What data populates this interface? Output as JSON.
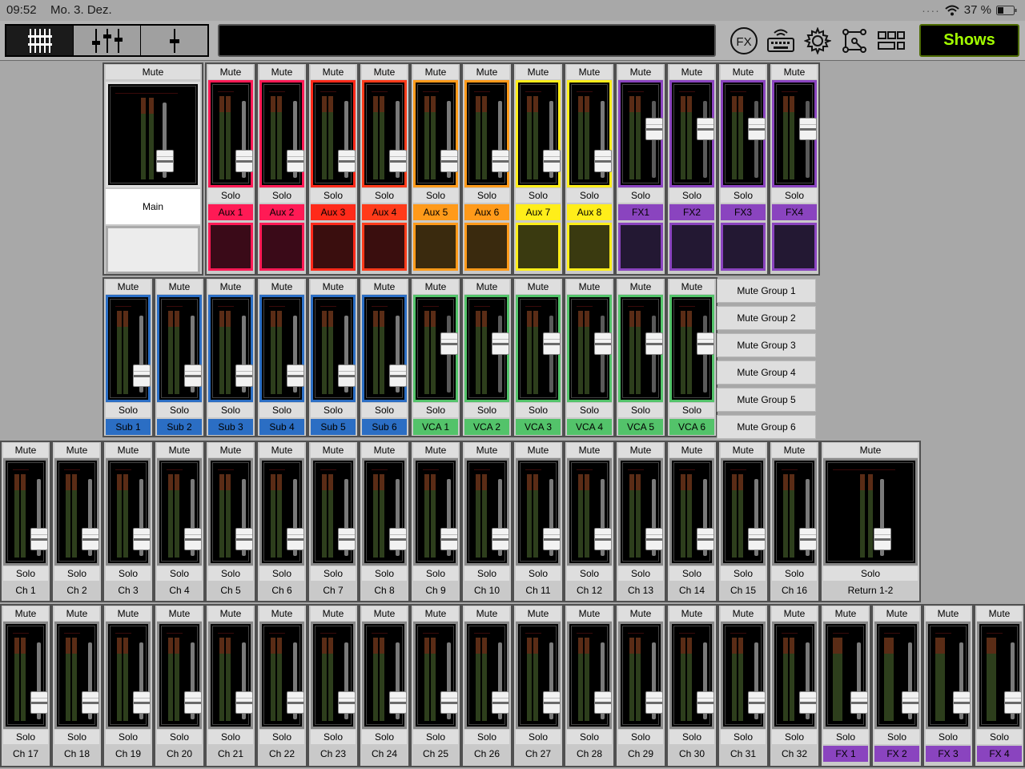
{
  "status": {
    "time": "09:52",
    "date": "Mo. 3. Dez.",
    "battery": "37 %",
    "dots": "····"
  },
  "toolbar": {
    "tabs": [
      {
        "name": "mixer-overview-tab",
        "icon": "fader-bank-icon",
        "active": true
      },
      {
        "name": "channel-view-tab",
        "icon": "three-faders-icon",
        "active": false
      },
      {
        "name": "single-fader-tab",
        "icon": "single-fader-icon",
        "active": false
      }
    ],
    "fx_label": "FX",
    "shows_label": "Shows"
  },
  "labels": {
    "mute": "Mute",
    "solo": "Solo"
  },
  "colors": {
    "aux_a": "#ff1a55",
    "aux_b": "#ff3b1a",
    "aux_c": "#ff9a1a",
    "aux_d": "#ffee1a",
    "fx": "#8a44bf",
    "sub": "#2b6ec4",
    "vca": "#53c36a",
    "ch_label": "#c9c9c9"
  },
  "row1": {
    "main": {
      "label": "Main",
      "level": 0.05
    },
    "strips": [
      {
        "label": "Aux 1",
        "color": "#ff1a55",
        "dark": "#3a0a18",
        "level": 0.05
      },
      {
        "label": "Aux 2",
        "color": "#ff1a55",
        "dark": "#3a0a18",
        "level": 0.05
      },
      {
        "label": "Aux 3",
        "color": "#ff2a1a",
        "dark": "#3a0e0e",
        "level": 0.05
      },
      {
        "label": "Aux 4",
        "color": "#ff3b1a",
        "dark": "#3a0e0e",
        "level": 0.05
      },
      {
        "label": "Aux 5",
        "color": "#ff9a1a",
        "dark": "#3a2a0e",
        "level": 0.05
      },
      {
        "label": "Aux 6",
        "color": "#ff9a1a",
        "dark": "#3a2a0e",
        "level": 0.05
      },
      {
        "label": "Aux 7",
        "color": "#ffee1a",
        "dark": "#3a3a10",
        "level": 0.05
      },
      {
        "label": "Aux 8",
        "color": "#ffee1a",
        "dark": "#3a3a10",
        "level": 0.05
      },
      {
        "label": "FX1",
        "color": "#8a44bf",
        "dark": "#231833",
        "level": 0.65
      },
      {
        "label": "FX2",
        "color": "#8a44bf",
        "dark": "#231833",
        "level": 0.65
      },
      {
        "label": "FX3",
        "color": "#8a44bf",
        "dark": "#231833",
        "level": 0.65
      },
      {
        "label": "FX4",
        "color": "#8a44bf",
        "dark": "#231833",
        "level": 0.65
      }
    ]
  },
  "row2": {
    "strips": [
      {
        "label": "Sub 1",
        "color": "#2b6ec4",
        "level": 0.05
      },
      {
        "label": "Sub 2",
        "color": "#2b6ec4",
        "level": 0.05
      },
      {
        "label": "Sub 3",
        "color": "#2b6ec4",
        "level": 0.05
      },
      {
        "label": "Sub 4",
        "color": "#2b6ec4",
        "level": 0.05
      },
      {
        "label": "Sub 5",
        "color": "#2b6ec4",
        "level": 0.05
      },
      {
        "label": "Sub 6",
        "color": "#2b6ec4",
        "level": 0.05
      },
      {
        "label": "VCA 1",
        "color": "#53c36a",
        "level": 0.65
      },
      {
        "label": "VCA 2",
        "color": "#53c36a",
        "level": 0.65
      },
      {
        "label": "VCA 3",
        "color": "#53c36a",
        "level": 0.65
      },
      {
        "label": "VCA 4",
        "color": "#53c36a",
        "level": 0.65
      },
      {
        "label": "VCA 5",
        "color": "#53c36a",
        "level": 0.65
      },
      {
        "label": "VCA 6",
        "color": "#53c36a",
        "level": 0.65
      }
    ],
    "mute_groups": [
      "Mute Group 1",
      "Mute Group 2",
      "Mute Group 3",
      "Mute Group 4",
      "Mute Group 5",
      "Mute Group 6"
    ]
  },
  "row3": {
    "strips": [
      "Ch 1",
      "Ch 2",
      "Ch 3",
      "Ch 4",
      "Ch 5",
      "Ch 6",
      "Ch 7",
      "Ch 8",
      "Ch 9",
      "Ch 10",
      "Ch 11",
      "Ch 12",
      "Ch 13",
      "Ch 14",
      "Ch 15",
      "Ch 16"
    ],
    "return": {
      "label": "Return 1-2",
      "level": 0.05
    }
  },
  "row4": {
    "strips": [
      "Ch 17",
      "Ch 18",
      "Ch 19",
      "Ch 20",
      "Ch 21",
      "Ch 22",
      "Ch 23",
      "Ch 24",
      "Ch 25",
      "Ch 26",
      "Ch 27",
      "Ch 28",
      "Ch 29",
      "Ch 30",
      "Ch 31",
      "Ch 32"
    ],
    "fx": [
      "FX 1",
      "FX 2",
      "FX 3",
      "FX 4"
    ]
  }
}
